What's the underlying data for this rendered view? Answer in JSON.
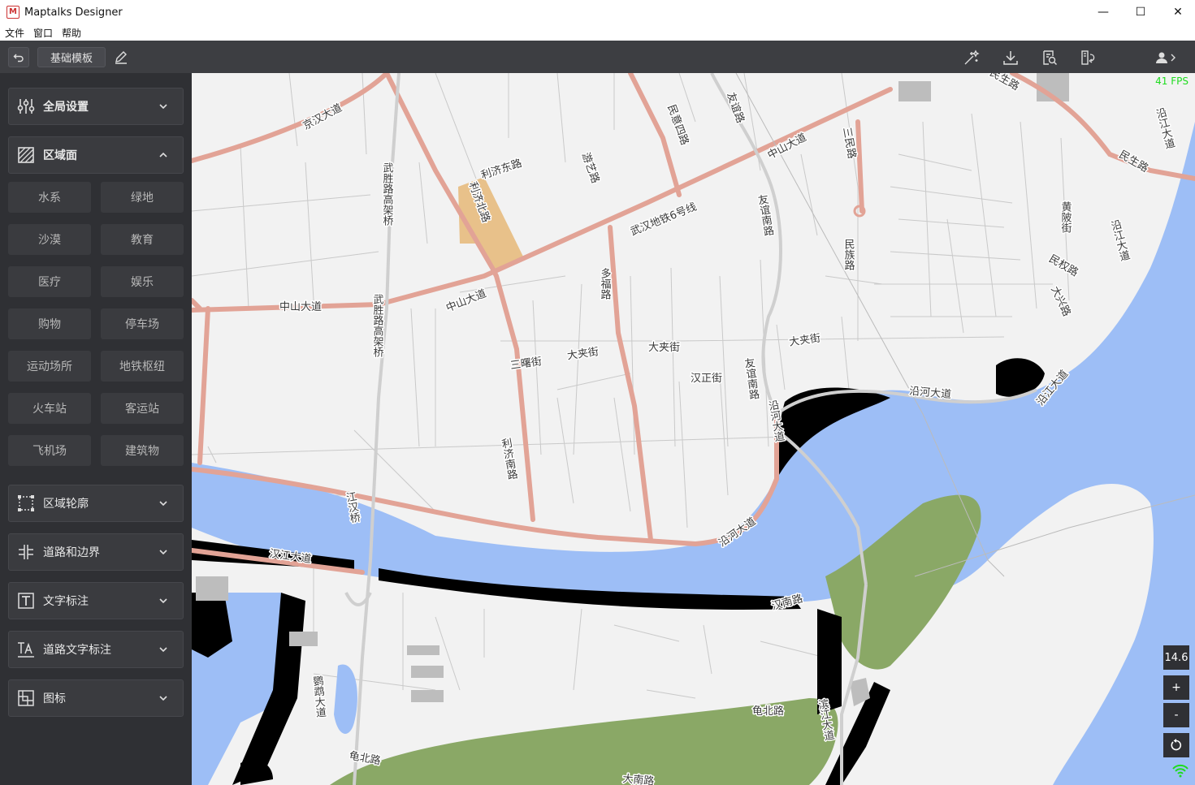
{
  "window": {
    "title": "Maptalks Designer",
    "minimize": "—",
    "maximize": "☐",
    "close": "✕"
  },
  "menu": [
    "文件",
    "窗口",
    "帮助"
  ],
  "toolbar": {
    "template_label": "基础模板"
  },
  "sidebar": {
    "sections": [
      {
        "label": "全局设置",
        "icon": "sliders-icon",
        "expanded": false
      },
      {
        "label": "区域面",
        "icon": "hatched-area-icon",
        "expanded": true
      },
      {
        "label": "区域轮廓",
        "icon": "dashed-outline-icon",
        "expanded": false
      },
      {
        "label": "道路和边界",
        "icon": "roads-icon",
        "expanded": false
      },
      {
        "label": "文字标注",
        "icon": "text-icon",
        "expanded": false
      },
      {
        "label": "道路文字标注",
        "icon": "road-text-icon",
        "expanded": false
      },
      {
        "label": "图标",
        "icon": "icon-layer-icon",
        "expanded": false
      }
    ],
    "area_items": [
      "水系",
      "绿地",
      "沙漠",
      "教育",
      "医疗",
      "娱乐",
      "购物",
      "停车场",
      "运动场所",
      "地铁枢纽",
      "火车站",
      "客运站",
      "飞机场",
      "建筑物"
    ]
  },
  "map": {
    "fps": "41 FPS",
    "zoom": "14.6",
    "zoom_in": "+",
    "zoom_out": "-",
    "colors": {
      "background": "#f2f2f2",
      "water": "#9dbef6",
      "green": "#8aa866",
      "road": "#e2a396",
      "minor_road": "#c9c9c9",
      "block": "#000000",
      "highlight": "#e8c18a"
    },
    "labels": {
      "jinghan": "京汉大道",
      "minsheng1": "民生路",
      "minsheng2": "民生路",
      "jiefang": "胜路",
      "lijidong": "利济东路",
      "lijibei": "利济北路",
      "minyi4": "民意四路",
      "youyi": "友谊路",
      "zhongshan1": "中山大道",
      "sanmin": "三民路",
      "youtun": "游艺路",
      "metro6": "武汉地铁6号线",
      "wusheng_ele1": "武胜路高架桥",
      "youyinan": "友谊南路",
      "zhongshan2": "中山大道",
      "zhongshan3": "中山大道",
      "duofu": "多福路",
      "minzu": "民族路",
      "minquan": "民权路",
      "huangpi": "黄陂街",
      "daxing": "大兴路",
      "yanjiang1": "沿江大道",
      "yanjiang2": "沿江大道",
      "wusheng_ele2": "武胜路高架桥",
      "sanyao": "三曙街",
      "dajia1": "大夹街",
      "dajia2": "大夹街",
      "dajia3": "大夹街",
      "hanzheng": "汉正街",
      "youyinan2": "友谊南路",
      "yanhe1": "沿河大道",
      "yanhe2": "沿河大道",
      "yanhe3": "沿河大道",
      "yanjiang3": "沿江大道",
      "lijinan": "利济南路",
      "jianghan": "江汉桥",
      "hanjiang": "汉江大道",
      "hannan": "汉南路",
      "yingwu": "鹦鹉大道",
      "guibei1": "龟北路",
      "guibei2": "龟北路",
      "binjiang": "滨江大道",
      "bottom": "大南路"
    }
  }
}
